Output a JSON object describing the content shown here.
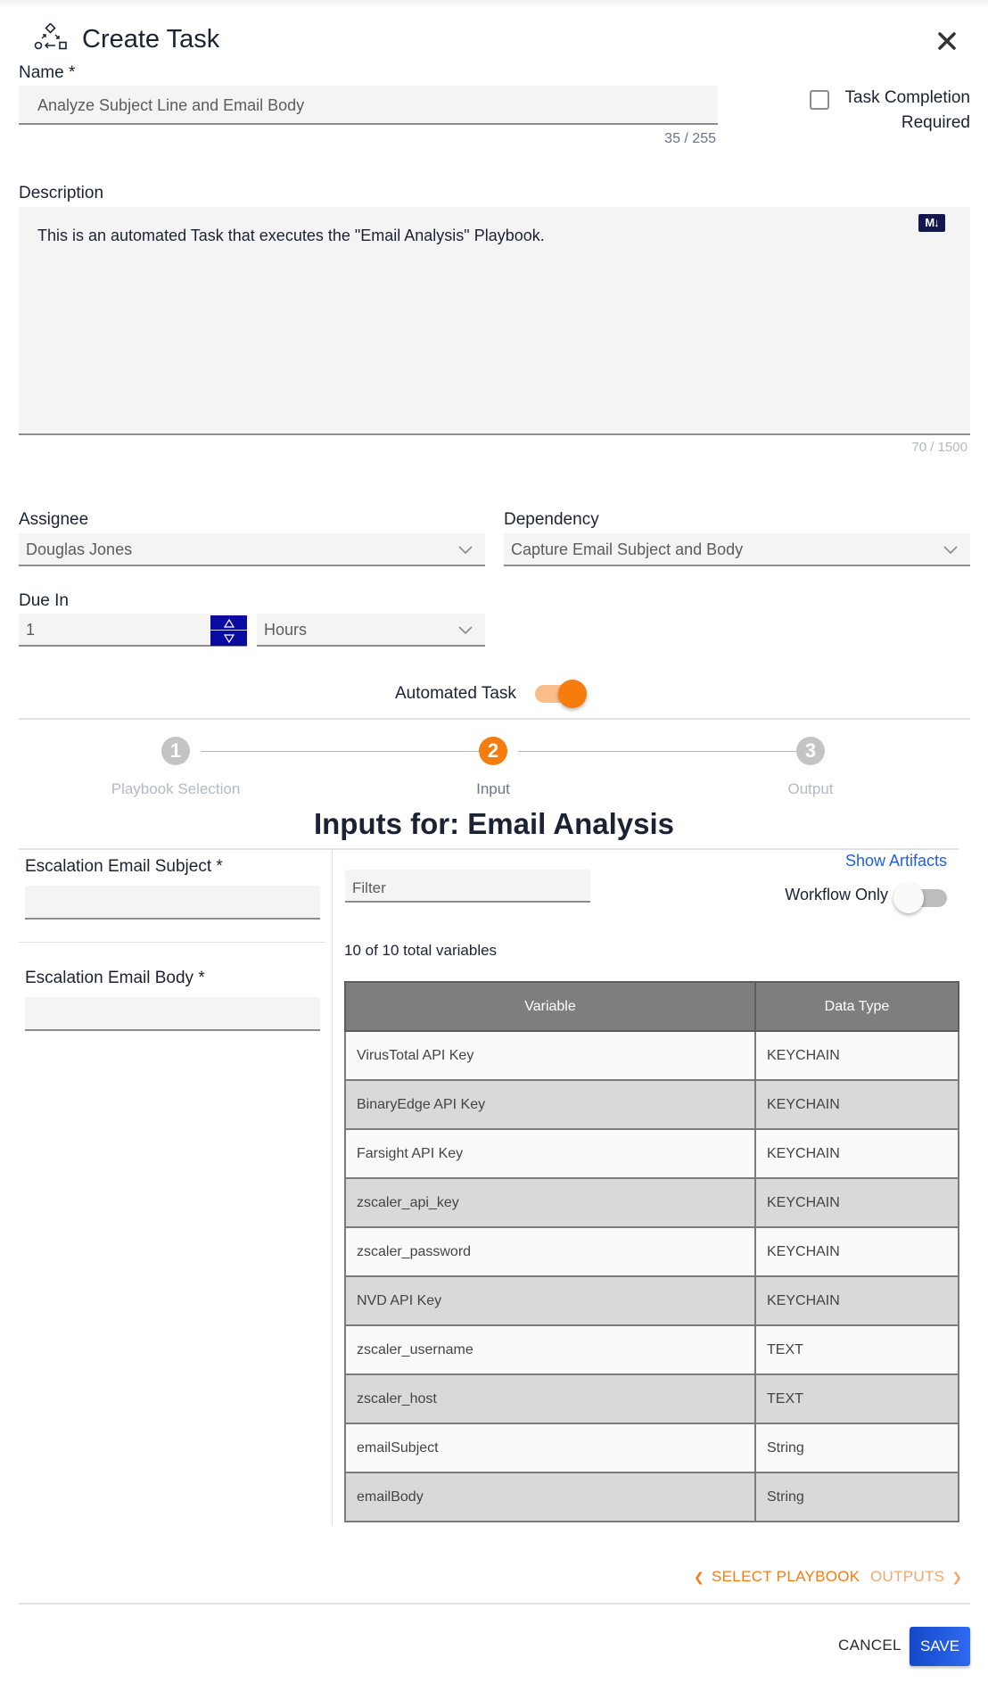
{
  "dialog": {
    "title": "Create Task",
    "close_icon": "close-icon",
    "title_icon": "workflow-icon"
  },
  "name_field": {
    "label": "Name *",
    "value": "Analyze Subject Line and Email Body",
    "counter": "35 / 255"
  },
  "task_completion": {
    "label_line1": "Task Completion",
    "label_line2": "Required",
    "checked": false
  },
  "description": {
    "label": "Description",
    "value": "This is an automated Task that executes the \"Email Analysis\" Playbook.",
    "counter": "70 / 1500",
    "markdown_badge": "M↓"
  },
  "assignee": {
    "label": "Assignee",
    "value": "Douglas Jones"
  },
  "dependency": {
    "label": "Dependency",
    "value": "Capture Email Subject and Body"
  },
  "due_in": {
    "label": "Due In",
    "value": "1",
    "unit": "Hours"
  },
  "automated_task": {
    "label": "Automated Task",
    "enabled": true
  },
  "stepper": {
    "steps": [
      {
        "number": "1",
        "label": "Playbook Selection",
        "state": "inactive"
      },
      {
        "number": "2",
        "label": "Input",
        "state": "active"
      },
      {
        "number": "3",
        "label": "Output",
        "state": "inactive"
      }
    ]
  },
  "inputs": {
    "heading": "Inputs for: Email Analysis",
    "fields": [
      {
        "label": "Escalation Email Subject *",
        "value": ""
      },
      {
        "label": "Escalation Email Body *",
        "value": ""
      }
    ],
    "filter_placeholder": "Filter",
    "show_artifacts": "Show Artifacts",
    "workflow_only": {
      "label": "Workflow Only",
      "enabled": false
    },
    "count_text": "10 of 10 total variables",
    "table": {
      "columns": [
        "Variable",
        "Data Type"
      ],
      "rows": [
        [
          "VirusTotal API Key",
          "KEYCHAIN"
        ],
        [
          "BinaryEdge API Key",
          "KEYCHAIN"
        ],
        [
          "Farsight API Key",
          "KEYCHAIN"
        ],
        [
          "zscaler_api_key",
          "KEYCHAIN"
        ],
        [
          "zscaler_password",
          "KEYCHAIN"
        ],
        [
          "NVD API Key",
          "KEYCHAIN"
        ],
        [
          "zscaler_username",
          "TEXT"
        ],
        [
          "zscaler_host",
          "TEXT"
        ],
        [
          "emailSubject",
          "String"
        ],
        [
          "emailBody",
          "String"
        ]
      ]
    }
  },
  "navigation": {
    "back_label": "SELECT PLAYBOOK",
    "next_label": "OUTPUTS"
  },
  "footer": {
    "cancel_label": "CANCEL",
    "save_label": "SAVE"
  },
  "colors": {
    "accent_orange": "#f57c0d",
    "accent_orange_light": "#fbbd8c",
    "step_inactive": "#c4c4c4",
    "link_blue": "#1f5fe6",
    "save_blue": "#1e55d8",
    "spinner_navy": "#0b0ba1"
  }
}
